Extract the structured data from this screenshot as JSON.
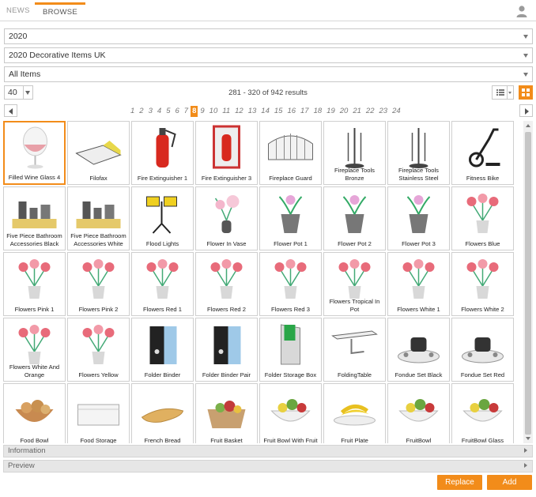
{
  "tabs": [
    {
      "label": "NEWS",
      "active": false
    },
    {
      "label": "BROWSE",
      "active": true
    }
  ],
  "filters": {
    "year": "2020",
    "catalog": "2020 Decorative Items UK",
    "category": "All Items"
  },
  "toolbar": {
    "per_page": "40",
    "results_text": "281 - 320 of 942 results"
  },
  "pagination": {
    "pages": [
      "1",
      "2",
      "3",
      "4",
      "5",
      "6",
      "7",
      "8",
      "9",
      "10",
      "11",
      "12",
      "13",
      "14",
      "15",
      "16",
      "17",
      "18",
      "19",
      "20",
      "21",
      "22",
      "23",
      "24"
    ],
    "current": "8"
  },
  "items": [
    {
      "label": "Filled Wine Glass 4",
      "icon": "wine-glass-icon",
      "selected": true
    },
    {
      "label": "Filofax",
      "icon": "filofax-icon"
    },
    {
      "label": "Fire Extinguisher 1",
      "icon": "fire-extinguisher-icon"
    },
    {
      "label": "Fire Extinguisher 3",
      "icon": "fire-extinguisher-cabinet-icon"
    },
    {
      "label": "Fireplace Guard",
      "icon": "fireplace-guard-icon"
    },
    {
      "label": "Fireplace Tools Bronze",
      "icon": "fireplace-tools-icon"
    },
    {
      "label": "Fireplace Tools Stainless Steel",
      "icon": "fireplace-tools-icon"
    },
    {
      "label": "Fitness Bike",
      "icon": "fitness-bike-icon"
    },
    {
      "label": "Five Piece Bathroom Accessories Black",
      "icon": "bathroom-set-icon"
    },
    {
      "label": "Five Piece Bathroom Accessories White",
      "icon": "bathroom-set-icon"
    },
    {
      "label": "Flood Lights",
      "icon": "flood-lights-icon"
    },
    {
      "label": "Flower In Vase",
      "icon": "flower-vase-icon"
    },
    {
      "label": "Flower Pot 1",
      "icon": "flower-pot-icon"
    },
    {
      "label": "Flower Pot 2",
      "icon": "flower-pot-icon"
    },
    {
      "label": "Flower Pot 3",
      "icon": "flower-pot-icon"
    },
    {
      "label": "Flowers Blue",
      "icon": "flowers-icon"
    },
    {
      "label": "Flowers Pink 1",
      "icon": "flowers-icon"
    },
    {
      "label": "Flowers Pink 2",
      "icon": "flowers-icon"
    },
    {
      "label": "Flowers Red 1",
      "icon": "flowers-icon"
    },
    {
      "label": "Flowers Red 2",
      "icon": "flowers-icon"
    },
    {
      "label": "Flowers Red 3",
      "icon": "flowers-icon"
    },
    {
      "label": "Flowers Tropical In Pot",
      "icon": "flowers-icon"
    },
    {
      "label": "Flowers White 1",
      "icon": "flowers-icon"
    },
    {
      "label": "Flowers White 2",
      "icon": "flowers-icon"
    },
    {
      "label": "Flowers White And Orange",
      "icon": "flowers-icon"
    },
    {
      "label": "Flowers Yellow",
      "icon": "flowers-icon"
    },
    {
      "label": "Folder Binder",
      "icon": "folder-binder-icon"
    },
    {
      "label": "Folder Binder Pair",
      "icon": "folder-binder-icon"
    },
    {
      "label": "Folder Storage Box",
      "icon": "storage-box-icon"
    },
    {
      "label": "FoldingTable",
      "icon": "folding-table-icon"
    },
    {
      "label": "Fondue Set Black",
      "icon": "fondue-set-icon"
    },
    {
      "label": "Fondue Set Red",
      "icon": "fondue-set-icon"
    },
    {
      "label": "Food Bowl",
      "icon": "food-bowl-icon"
    },
    {
      "label": "Food Storage",
      "icon": "food-storage-icon"
    },
    {
      "label": "French Bread",
      "icon": "bread-icon"
    },
    {
      "label": "Fruit Basket",
      "icon": "fruit-basket-icon"
    },
    {
      "label": "Fruit Bowl With Fruit",
      "icon": "fruit-bowl-icon"
    },
    {
      "label": "Fruit Plate",
      "icon": "fruit-plate-icon"
    },
    {
      "label": "FruitBowl",
      "icon": "fruit-bowl-icon"
    },
    {
      "label": "FruitBowl Glass",
      "icon": "fruit-bowl-icon"
    }
  ],
  "panels": {
    "information": "Information",
    "preview": "Preview"
  },
  "actions": {
    "replace": "Replace",
    "add": "Add"
  },
  "colors": {
    "accent": "#f28c1a"
  }
}
